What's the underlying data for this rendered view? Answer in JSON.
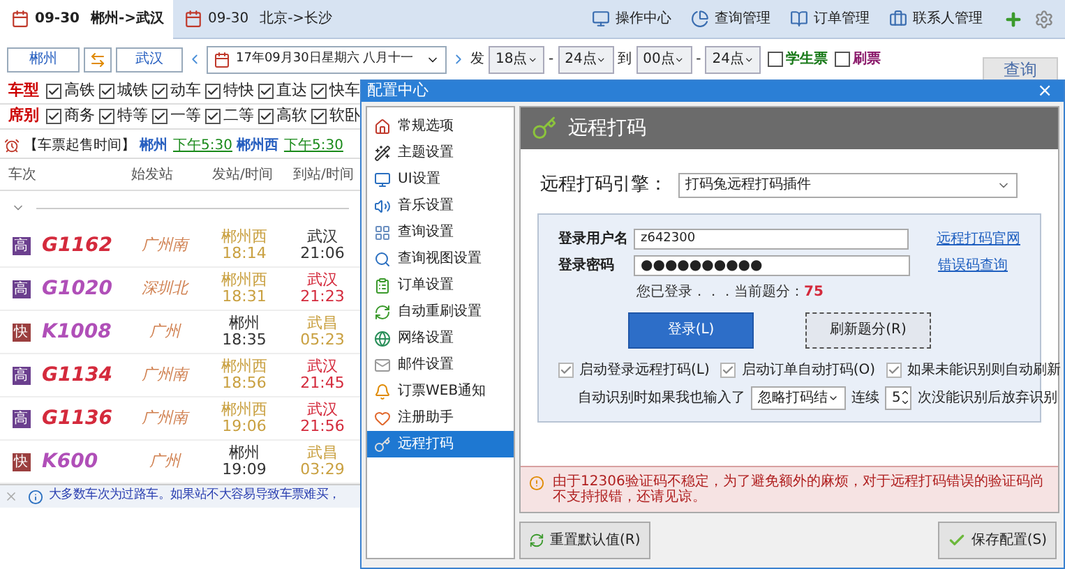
{
  "tabs": [
    {
      "label": "09-30",
      "route": "郴州->武汉",
      "selected": true
    },
    {
      "label": "09-30",
      "route": "北京->长沙",
      "selected": false
    }
  ],
  "menu": [
    "操作中心",
    "查询管理",
    "订单管理",
    "联系人管理"
  ],
  "search": {
    "from": "郴州",
    "to": "武汉",
    "date": "17年09月30日星期六  八月十一",
    "depart_label": "发",
    "depart_from": "18点",
    "depart_to": "24点",
    "arrive_label": "到",
    "arrive_from": "00点",
    "arrive_to": "24点",
    "dash": "-",
    "options": [
      {
        "label": "学生票",
        "checked": false,
        "color": "#1a7a1a"
      },
      {
        "label": "刷票",
        "checked": false,
        "color": "#8b1a6b"
      }
    ],
    "query": "查询"
  },
  "filters": [
    {
      "title": "车型",
      "items": [
        {
          "label": "高铁",
          "checked": true
        },
        {
          "label": "城铁",
          "checked": true
        },
        {
          "label": "动车",
          "checked": true
        },
        {
          "label": "特快",
          "checked": true
        },
        {
          "label": "直达",
          "checked": true
        },
        {
          "label": "快车",
          "checked": true
        }
      ]
    },
    {
      "title": "席别",
      "items": [
        {
          "label": "商务",
          "checked": true
        },
        {
          "label": "特等",
          "checked": true
        },
        {
          "label": "一等",
          "checked": true
        },
        {
          "label": "二等",
          "checked": true
        },
        {
          "label": "高软",
          "checked": true
        },
        {
          "label": "软卧",
          "checked": true
        }
      ]
    }
  ],
  "notice": {
    "title": "【车票起售时间】",
    "entries": [
      {
        "station": "郴州",
        "time": "下午5:30"
      },
      {
        "station": "郴州西",
        "time": "下午5:30"
      }
    ]
  },
  "table": {
    "columns": [
      "车次",
      "始发站",
      "发站/时间",
      "到站/时间"
    ],
    "expanded": true,
    "rows": [
      {
        "badge": {
          "text": "高",
          "color": "#6b3f8e"
        },
        "train": {
          "text": "G1162",
          "color": "#d42a3c"
        },
        "origin": "广州南",
        "depart": {
          "station": "郴州西",
          "time": "18:14",
          "color": "#c9a040"
        },
        "arrive": {
          "station": "武汉",
          "time": "21:06",
          "color": "#333333"
        }
      },
      {
        "badge": {
          "text": "高",
          "color": "#6b3f8e"
        },
        "train": {
          "text": "G1020",
          "color": "#b04fb8"
        },
        "origin": "深圳北",
        "depart": {
          "station": "郴州西",
          "time": "18:31",
          "color": "#c9a040"
        },
        "arrive": {
          "station": "武汉",
          "time": "21:23",
          "color": "#d42a3c"
        }
      },
      {
        "badge": {
          "text": "快",
          "color": "#9b3f3f"
        },
        "train": {
          "text": "K1008",
          "color": "#b04fb8"
        },
        "origin": "广州",
        "depart": {
          "station": "郴州",
          "time": "18:35",
          "color": "#333333"
        },
        "arrive": {
          "station": "武昌",
          "time": "05:23",
          "color": "#c9a040"
        }
      },
      {
        "badge": {
          "text": "高",
          "color": "#6b3f8e"
        },
        "train": {
          "text": "G1134",
          "color": "#d42a3c"
        },
        "origin": "广州南",
        "depart": {
          "station": "郴州西",
          "time": "18:56",
          "color": "#c9a040"
        },
        "arrive": {
          "station": "武汉",
          "time": "21:45",
          "color": "#d42a3c"
        }
      },
      {
        "badge": {
          "text": "高",
          "color": "#6b3f8e"
        },
        "train": {
          "text": "G1136",
          "color": "#d42a3c"
        },
        "origin": "广州南",
        "depart": {
          "station": "郴州西",
          "time": "19:06",
          "color": "#c9a040"
        },
        "arrive": {
          "station": "武汉",
          "time": "21:56",
          "color": "#d42a3c"
        }
      },
      {
        "badge": {
          "text": "快",
          "color": "#9b3f3f"
        },
        "train": {
          "text": "K600",
          "color": "#b04fb8"
        },
        "origin": "广州",
        "depart": {
          "station": "郴州",
          "time": "19:09",
          "color": "#333333"
        },
        "arrive": {
          "station": "武昌",
          "time": "03:29",
          "color": "#c9a040"
        }
      }
    ]
  },
  "status_bar": "大多数车次为过路车。如果站不大容易导致车票难买，",
  "dialog": {
    "title": "配置中心",
    "close": "×",
    "sidebar": [
      {
        "label": "常规选项",
        "selected": false
      },
      {
        "label": "主题设置",
        "selected": false
      },
      {
        "label": "UI设置",
        "selected": false
      },
      {
        "label": "音乐设置",
        "selected": false
      },
      {
        "label": "查询设置",
        "selected": false
      },
      {
        "label": "查询视图设置",
        "selected": false
      },
      {
        "label": "订单设置",
        "selected": false
      },
      {
        "label": "自动重刷设置",
        "selected": false
      },
      {
        "label": "网络设置",
        "selected": false
      },
      {
        "label": "邮件设置",
        "selected": false
      },
      {
        "label": "订票WEB通知",
        "selected": false
      },
      {
        "label": "注册助手",
        "selected": false
      },
      {
        "label": "远程打码",
        "selected": true
      }
    ],
    "heading": "远程打码",
    "engine_label": "远程打码引擎：",
    "engine": "打码兔远程打码插件",
    "username_label": "登录用户名",
    "username": "z642300",
    "password_label": "登录密码",
    "password": "●●●●●●●●●●",
    "links": [
      "远程打码官网",
      "错误码查询"
    ],
    "status": "您已登录．．．当前题分：",
    "score": "75",
    "login_button": "登录(L)",
    "refresh_button": "刷新题分(R)",
    "checks": [
      {
        "label": "启动登录远程打码(L)",
        "checked": true
      },
      {
        "label": "启动订单自动打码(O)",
        "checked": true
      },
      {
        "label": "如果未能识别则自动刷新",
        "checked": true
      }
    ],
    "auto_label": "自动识别时如果我也输入了",
    "auto_select": "忽略打码结",
    "repeat_label": "连续",
    "repeat": "5",
    "giveup_label": "次没能识别后放弃识别",
    "warning": "由于12306验证码不稳定，为了避免额外的麻烦，对于远程打码错误的验证码尚不支持报错，还请见谅。",
    "reset_button": "重置默认值(R)",
    "save_button": "保存配置(S)"
  }
}
